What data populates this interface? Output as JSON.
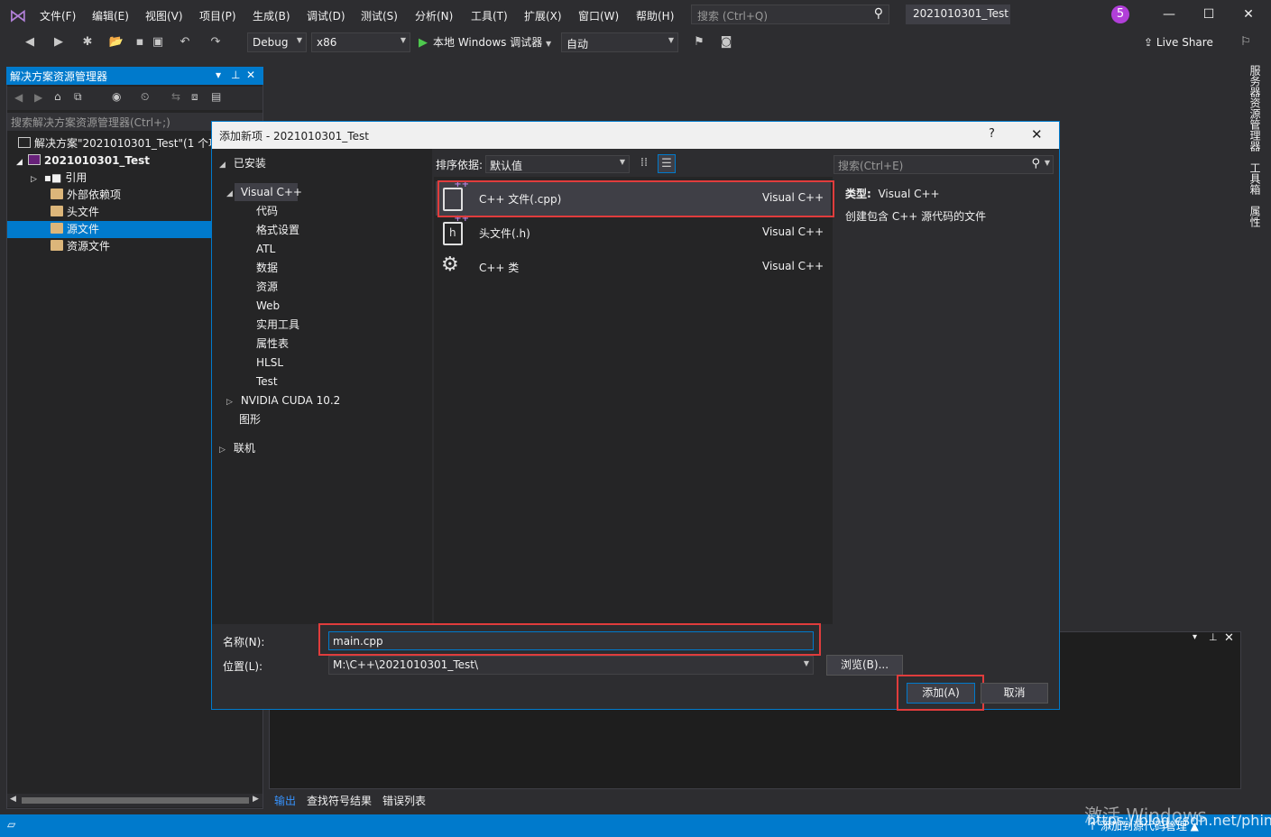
{
  "titlebar": {
    "menus": [
      "文件(F)",
      "编辑(E)",
      "视图(V)",
      "项目(P)",
      "生成(B)",
      "调试(D)",
      "测试(S)",
      "分析(N)",
      "工具(T)",
      "扩展(X)",
      "窗口(W)",
      "帮助(H)"
    ],
    "search_placeholder": "搜索 (Ctrl+Q)",
    "solution_name": "2021010301_Test",
    "notification_count": "5"
  },
  "toolbar": {
    "config": "Debug",
    "platform": "x86",
    "run_label": "本地 Windows 调试器",
    "mode": "自动",
    "live_share": "Live Share"
  },
  "right_rail": {
    "tabs": [
      "服务器资源管理器",
      "工具箱",
      "属性"
    ]
  },
  "solution_explorer": {
    "title": "解决方案资源管理器",
    "search_placeholder": "搜索解决方案资源管理器(Ctrl+;)",
    "solution_row": "解决方案\"2021010301_Test\"(1 个项",
    "project_row": "2021010301_Test",
    "items": [
      "引用",
      "外部依赖项",
      "头文件",
      "源文件",
      "资源文件"
    ],
    "selected": "源文件"
  },
  "output_panel": {
    "tabs": [
      "输出",
      "查找符号结果",
      "错误列表"
    ]
  },
  "statusbar": {
    "text": "↑ 添加到源代码管理 ▲",
    "watermark_line1": "激活 Windows",
    "watermark_line2": "https://blog.csdn.net/phinoo"
  },
  "dialog": {
    "title": "添加新项 - 2021010301_Test",
    "help": "?",
    "close": "✕",
    "tree": {
      "installed": "已安装",
      "visual_cpp": "Visual C++",
      "children": [
        "代码",
        "格式设置",
        "ATL",
        "数据",
        "资源",
        "Web",
        "实用工具",
        "属性表",
        "HLSL",
        "Test"
      ],
      "cuda": "NVIDIA CUDA 10.2",
      "graphics": "图形",
      "online": "联机"
    },
    "sort_label": "排序依据:",
    "sort_value": "默认值",
    "search_placeholder": "搜索(Ctrl+E)",
    "items": [
      {
        "name": "C++ 文件(.cpp)",
        "lang": "Visual C++",
        "icon": "cpp-file-icon"
      },
      {
        "name": "头文件(.h)",
        "lang": "Visual C++",
        "icon": "header-file-icon"
      },
      {
        "name": "C++ 类",
        "lang": "Visual C++",
        "icon": "class-icon"
      }
    ],
    "type_label": "类型:",
    "type_value": "Visual C++",
    "description": "创建包含 C++ 源代码的文件",
    "name_label": "名称(N):",
    "name_value": "main.cpp",
    "location_label": "位置(L):",
    "location_value": "M:\\C++\\2021010301_Test\\",
    "browse": "浏览(B)...",
    "add": "添加(A)",
    "cancel": "取消"
  },
  "colors": {
    "accent": "#007acc",
    "highlight": "#e03c3c",
    "background": "#2d2d30"
  }
}
